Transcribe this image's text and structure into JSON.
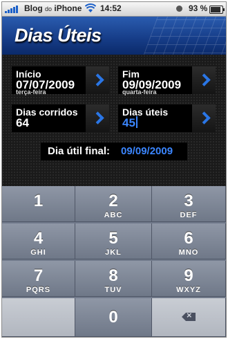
{
  "status_bar": {
    "carrier": "Blog",
    "carrier_small": "do",
    "carrier_suffix": "iPhone",
    "time": "14:52",
    "battery": "93 %",
    "icons": [
      "signal-icon",
      "wifi-icon",
      "alarm-icon",
      "battery-icon"
    ]
  },
  "header": {
    "title": "Dias Úteis"
  },
  "inicio": {
    "label": "Início",
    "date": "07/07/2009",
    "weekday": "terça-feira"
  },
  "fim": {
    "label": "Fim",
    "date": "09/09/2009",
    "weekday": "quarta-feira"
  },
  "dias_corridos": {
    "label": "Dias corridos",
    "value": "64"
  },
  "dias_uteis": {
    "label": "Dias úteis",
    "value": "45"
  },
  "final": {
    "label": "Dia útil final:",
    "value": "09/09/2009"
  },
  "keypad": {
    "keys": [
      {
        "num": "1",
        "letters": ""
      },
      {
        "num": "2",
        "letters": "ABC"
      },
      {
        "num": "3",
        "letters": "DEF"
      },
      {
        "num": "4",
        "letters": "GHI"
      },
      {
        "num": "5",
        "letters": "JKL"
      },
      {
        "num": "6",
        "letters": "MNO"
      },
      {
        "num": "7",
        "letters": "PQRS"
      },
      {
        "num": "8",
        "letters": "TUV"
      },
      {
        "num": "9",
        "letters": "WXYZ"
      },
      {
        "num": "0",
        "letters": ""
      }
    ]
  },
  "colors": {
    "accent": "#3b86ff",
    "header": "#173e8a",
    "keypad": "#7b8494"
  }
}
